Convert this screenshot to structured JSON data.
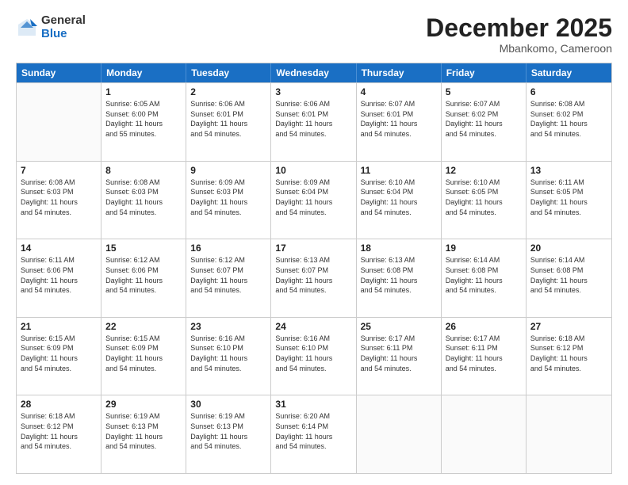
{
  "header": {
    "logo_general": "General",
    "logo_blue": "Blue",
    "month_title": "December 2025",
    "subtitle": "Mbankomo, Cameroon"
  },
  "weekdays": [
    "Sunday",
    "Monday",
    "Tuesday",
    "Wednesday",
    "Thursday",
    "Friday",
    "Saturday"
  ],
  "weeks": [
    [
      {
        "day": "",
        "info": ""
      },
      {
        "day": "1",
        "info": "Sunrise: 6:05 AM\nSunset: 6:00 PM\nDaylight: 11 hours\nand 55 minutes."
      },
      {
        "day": "2",
        "info": "Sunrise: 6:06 AM\nSunset: 6:01 PM\nDaylight: 11 hours\nand 54 minutes."
      },
      {
        "day": "3",
        "info": "Sunrise: 6:06 AM\nSunset: 6:01 PM\nDaylight: 11 hours\nand 54 minutes."
      },
      {
        "day": "4",
        "info": "Sunrise: 6:07 AM\nSunset: 6:01 PM\nDaylight: 11 hours\nand 54 minutes."
      },
      {
        "day": "5",
        "info": "Sunrise: 6:07 AM\nSunset: 6:02 PM\nDaylight: 11 hours\nand 54 minutes."
      },
      {
        "day": "6",
        "info": "Sunrise: 6:08 AM\nSunset: 6:02 PM\nDaylight: 11 hours\nand 54 minutes."
      }
    ],
    [
      {
        "day": "7",
        "info": "Sunrise: 6:08 AM\nSunset: 6:03 PM\nDaylight: 11 hours\nand 54 minutes."
      },
      {
        "day": "8",
        "info": "Sunrise: 6:08 AM\nSunset: 6:03 PM\nDaylight: 11 hours\nand 54 minutes."
      },
      {
        "day": "9",
        "info": "Sunrise: 6:09 AM\nSunset: 6:03 PM\nDaylight: 11 hours\nand 54 minutes."
      },
      {
        "day": "10",
        "info": "Sunrise: 6:09 AM\nSunset: 6:04 PM\nDaylight: 11 hours\nand 54 minutes."
      },
      {
        "day": "11",
        "info": "Sunrise: 6:10 AM\nSunset: 6:04 PM\nDaylight: 11 hours\nand 54 minutes."
      },
      {
        "day": "12",
        "info": "Sunrise: 6:10 AM\nSunset: 6:05 PM\nDaylight: 11 hours\nand 54 minutes."
      },
      {
        "day": "13",
        "info": "Sunrise: 6:11 AM\nSunset: 6:05 PM\nDaylight: 11 hours\nand 54 minutes."
      }
    ],
    [
      {
        "day": "14",
        "info": "Sunrise: 6:11 AM\nSunset: 6:06 PM\nDaylight: 11 hours\nand 54 minutes."
      },
      {
        "day": "15",
        "info": "Sunrise: 6:12 AM\nSunset: 6:06 PM\nDaylight: 11 hours\nand 54 minutes."
      },
      {
        "day": "16",
        "info": "Sunrise: 6:12 AM\nSunset: 6:07 PM\nDaylight: 11 hours\nand 54 minutes."
      },
      {
        "day": "17",
        "info": "Sunrise: 6:13 AM\nSunset: 6:07 PM\nDaylight: 11 hours\nand 54 minutes."
      },
      {
        "day": "18",
        "info": "Sunrise: 6:13 AM\nSunset: 6:08 PM\nDaylight: 11 hours\nand 54 minutes."
      },
      {
        "day": "19",
        "info": "Sunrise: 6:14 AM\nSunset: 6:08 PM\nDaylight: 11 hours\nand 54 minutes."
      },
      {
        "day": "20",
        "info": "Sunrise: 6:14 AM\nSunset: 6:08 PM\nDaylight: 11 hours\nand 54 minutes."
      }
    ],
    [
      {
        "day": "21",
        "info": "Sunrise: 6:15 AM\nSunset: 6:09 PM\nDaylight: 11 hours\nand 54 minutes."
      },
      {
        "day": "22",
        "info": "Sunrise: 6:15 AM\nSunset: 6:09 PM\nDaylight: 11 hours\nand 54 minutes."
      },
      {
        "day": "23",
        "info": "Sunrise: 6:16 AM\nSunset: 6:10 PM\nDaylight: 11 hours\nand 54 minutes."
      },
      {
        "day": "24",
        "info": "Sunrise: 6:16 AM\nSunset: 6:10 PM\nDaylight: 11 hours\nand 54 minutes."
      },
      {
        "day": "25",
        "info": "Sunrise: 6:17 AM\nSunset: 6:11 PM\nDaylight: 11 hours\nand 54 minutes."
      },
      {
        "day": "26",
        "info": "Sunrise: 6:17 AM\nSunset: 6:11 PM\nDaylight: 11 hours\nand 54 minutes."
      },
      {
        "day": "27",
        "info": "Sunrise: 6:18 AM\nSunset: 6:12 PM\nDaylight: 11 hours\nand 54 minutes."
      }
    ],
    [
      {
        "day": "28",
        "info": "Sunrise: 6:18 AM\nSunset: 6:12 PM\nDaylight: 11 hours\nand 54 minutes."
      },
      {
        "day": "29",
        "info": "Sunrise: 6:19 AM\nSunset: 6:13 PM\nDaylight: 11 hours\nand 54 minutes."
      },
      {
        "day": "30",
        "info": "Sunrise: 6:19 AM\nSunset: 6:13 PM\nDaylight: 11 hours\nand 54 minutes."
      },
      {
        "day": "31",
        "info": "Sunrise: 6:20 AM\nSunset: 6:14 PM\nDaylight: 11 hours\nand 54 minutes."
      },
      {
        "day": "",
        "info": ""
      },
      {
        "day": "",
        "info": ""
      },
      {
        "day": "",
        "info": ""
      }
    ]
  ]
}
